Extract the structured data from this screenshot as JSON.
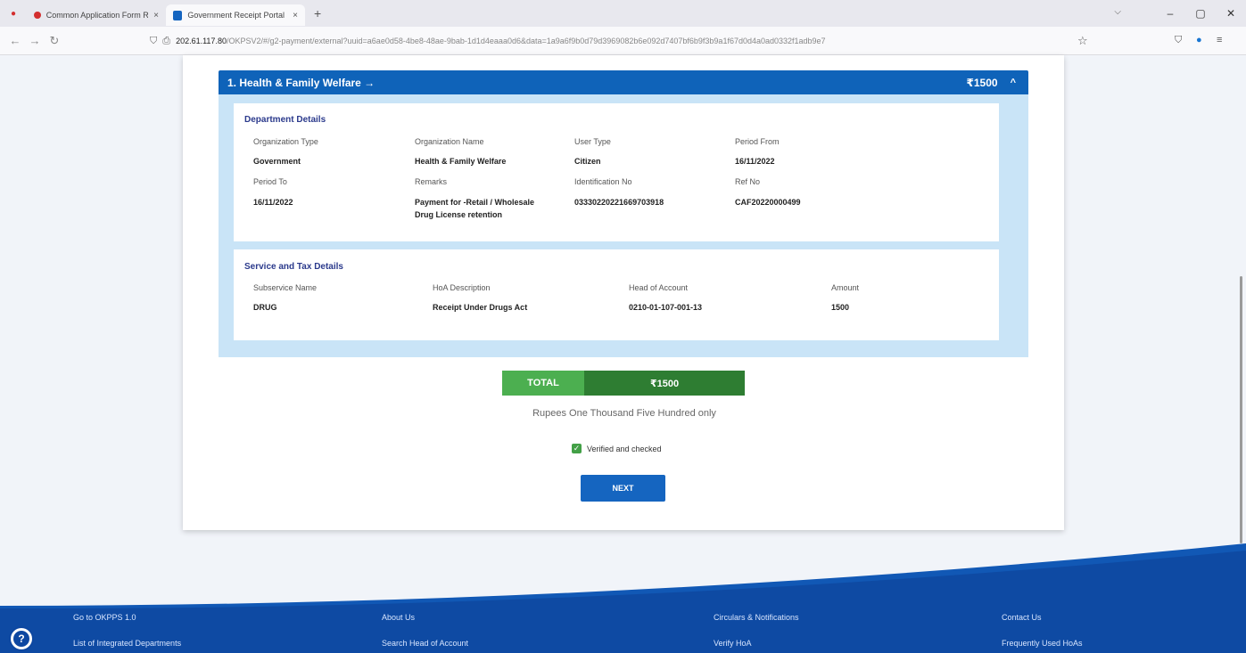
{
  "browser": {
    "tabs": [
      {
        "title": "Common Application Form Resu",
        "fav_color": "#d32f2f",
        "active": false
      },
      {
        "title": "Government Receipt Portal Sy",
        "fav_color": "#1565c0",
        "active": true
      }
    ],
    "new_tab": "+",
    "close": "×",
    "url_host": "202.61.117.80",
    "url_path": "/OKPSV2/#/g2-payment/external?uuid=a6ae0d58-4be8-48ae-9bab-1d1d4eaaa0d6&data=1a9a6f9b0d79d3969082b6e092d7407bf6b9f3b9a1f67d0d4a0ad0332f1adb9e7",
    "window_controls": [
      "–",
      "▢",
      "✕"
    ]
  },
  "department": {
    "title": "1. Health & Family Welfare →",
    "amount": "₹1500",
    "chevron": "^",
    "details_title": "Department Details",
    "fields": [
      {
        "label": "Organization Type",
        "value": "Government"
      },
      {
        "label": "Organization Name",
        "value": "Health & Family Welfare"
      },
      {
        "label": "User Type",
        "value": "Citizen"
      },
      {
        "label": "Period From",
        "value": "16/11/2022"
      },
      {
        "label": "Period To",
        "value": "16/11/2022"
      },
      {
        "label": "Remarks",
        "value": "Payment for -Retail / Wholesale",
        "value2": "Drug License retention"
      },
      {
        "label": "Identification No",
        "value": "03330220221669703918"
      },
      {
        "label": "Ref No",
        "value": "CAF20220000499"
      }
    ],
    "service_title": "Service and Tax Details",
    "service_headers": [
      "Subservice Name",
      "HoA Description",
      "Head of Account",
      "Amount"
    ],
    "service_row": [
      "DRUG",
      "Receipt Under Drugs Act",
      "0210-01-107-001-13",
      "1500"
    ]
  },
  "total": {
    "label": "TOTAL",
    "value": "₹1500",
    "words": "Rupees One Thousand Five Hundred only",
    "verified_label": "Verified and checked",
    "next_label": "NEXT"
  },
  "footer": {
    "col1": [
      "Go to OKPPS 1.0",
      "List of Integrated Departments"
    ],
    "col2": [
      "About Us",
      "Search Head of Account"
    ],
    "col3": [
      "Circulars & Notifications",
      "Verify HoA"
    ],
    "col4": [
      "Contact Us",
      "Frequently Used HoAs"
    ]
  }
}
